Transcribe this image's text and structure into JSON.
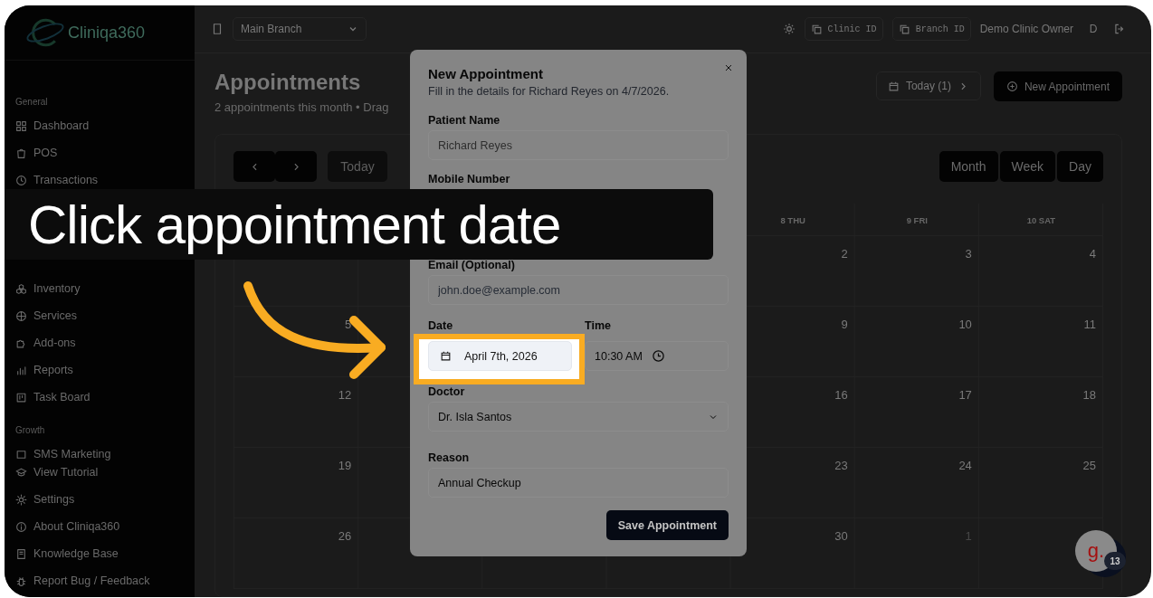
{
  "sidebar": {
    "logo": "Cliniqa360",
    "sections": [
      {
        "title": "General",
        "items": [
          "Dashboard",
          "POS",
          "Transactions"
        ]
      },
      {
        "items": [
          "Inventory",
          "Services",
          "Add-ons",
          "Reports",
          "Task Board"
        ]
      },
      {
        "title": "Growth",
        "items": [
          "SMS Marketing"
        ]
      }
    ],
    "footer_items": [
      "View Tutorial",
      "Settings",
      "About Cliniqa360",
      "Knowledge Base",
      "Report Bug / Feedback"
    ]
  },
  "topbar": {
    "branch": "Main Branch",
    "clinic_id": "Clinic ID",
    "branch_id": "Branch ID",
    "user": "Demo Clinic Owner",
    "avatar": "D"
  },
  "page": {
    "title": "Appointments",
    "subtitle": "2 appointments this month • Drag",
    "today_button": "Today (1)",
    "new_button": "New Appointment"
  },
  "calendar": {
    "today": "Today",
    "views": [
      "Month",
      "Week",
      "Day"
    ],
    "headers": [
      {
        "kind": "blank"
      },
      {
        "kind": "blank"
      },
      {
        "kind": "blank"
      },
      {
        "kind": "blank"
      },
      {
        "kind": "weekday",
        "label": "8 THU"
      },
      {
        "kind": "weekday",
        "label": "9 FRI"
      },
      {
        "kind": "weekday",
        "label": "10 SAT"
      }
    ],
    "weeks": [
      [
        {
          "kind": "blank"
        },
        {
          "kind": "blank"
        },
        {
          "kind": "blank"
        },
        {
          "kind": "blank"
        },
        {
          "kind": "day",
          "day": "2",
          "muted": false
        },
        {
          "kind": "day",
          "day": "3",
          "muted": false
        },
        {
          "kind": "day",
          "day": "4",
          "muted": false
        }
      ],
      [
        {
          "kind": "day",
          "day": "5",
          "muted": false
        },
        {
          "kind": "blank"
        },
        {
          "kind": "blank"
        },
        {
          "kind": "blank"
        },
        {
          "kind": "day",
          "day": "9",
          "muted": false
        },
        {
          "kind": "day",
          "day": "10",
          "muted": false
        },
        {
          "kind": "day",
          "day": "11",
          "muted": false
        }
      ],
      [
        {
          "kind": "day",
          "day": "12",
          "muted": false
        },
        {
          "kind": "blank"
        },
        {
          "kind": "blank"
        },
        {
          "kind": "blank"
        },
        {
          "kind": "day",
          "day": "16",
          "muted": false
        },
        {
          "kind": "day",
          "day": "17",
          "muted": false
        },
        {
          "kind": "day",
          "day": "18",
          "muted": false
        }
      ],
      [
        {
          "kind": "day",
          "day": "19",
          "muted": false
        },
        {
          "kind": "blank"
        },
        {
          "kind": "blank"
        },
        {
          "kind": "blank"
        },
        {
          "kind": "day",
          "day": "23",
          "muted": false
        },
        {
          "kind": "day",
          "day": "24",
          "muted": false
        },
        {
          "kind": "day",
          "day": "25",
          "muted": false
        }
      ],
      [
        {
          "kind": "day",
          "day": "26",
          "muted": false
        },
        {
          "kind": "blank"
        },
        {
          "kind": "blank"
        },
        {
          "kind": "blank"
        },
        {
          "kind": "day",
          "day": "30",
          "muted": false
        },
        {
          "kind": "day",
          "day": "1",
          "muted": true
        },
        {
          "kind": "blank"
        }
      ]
    ]
  },
  "modal": {
    "title": "New Appointment",
    "description": "Fill in the details for Richard Reyes on 4/7/2026.",
    "patient": {
      "label": "Patient Name",
      "value": "Richard Reyes",
      "disabled": true
    },
    "mobile": {
      "label": "Mobile Number"
    },
    "email": {
      "label": "Email (Optional)",
      "placeholder": "john.doe@example.com"
    },
    "date": {
      "label": "Date",
      "value": "April 7th, 2026"
    },
    "time": {
      "label": "Time",
      "value": "10:30 AM"
    },
    "doctor": {
      "label": "Doctor",
      "value": "Dr. Isla Santos"
    },
    "reason": {
      "label": "Reason",
      "value": "Annual Checkup"
    },
    "save_button": "Save Appointment"
  },
  "caption": "Click appointment date",
  "chat_widget": {
    "logo": "g.",
    "count": "13"
  }
}
